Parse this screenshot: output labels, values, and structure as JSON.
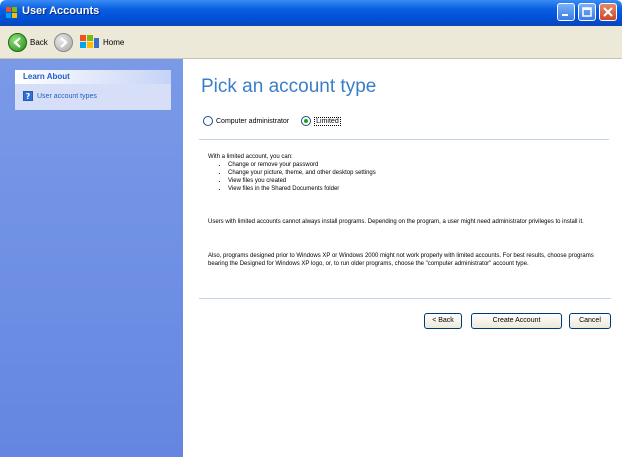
{
  "window": {
    "title": "User Accounts"
  },
  "toolbar": {
    "back_label": "Back",
    "home_label": "Home"
  },
  "sidebar": {
    "panel_title": "Learn About",
    "items": [
      {
        "label": "User account types",
        "icon": "help-icon"
      }
    ]
  },
  "main": {
    "heading": "Pick an account type",
    "account_types": [
      {
        "label": "Computer administrator",
        "checked": false
      },
      {
        "label": "Limited",
        "checked": true
      }
    ],
    "intro": "With a limited account, you can:",
    "bullets": [
      "Change or remove your password",
      "Change your picture, theme, and other desktop settings",
      "View files you created",
      "View files in the Shared Documents folder"
    ],
    "paragraph1": "Users with limited accounts cannot always install programs. Depending on the program, a user might need administrator privileges to install it.",
    "paragraph2": "Also, programs designed prior to Windows XP or Windows 2000 might not work properly with limited accounts. For best results, choose programs bearing the Designed for Windows XP logo, or, to run older programs, choose the \"computer administrator\" account type."
  },
  "buttons": {
    "back": "< Back",
    "create": "Create Account",
    "cancel": "Cancel"
  }
}
